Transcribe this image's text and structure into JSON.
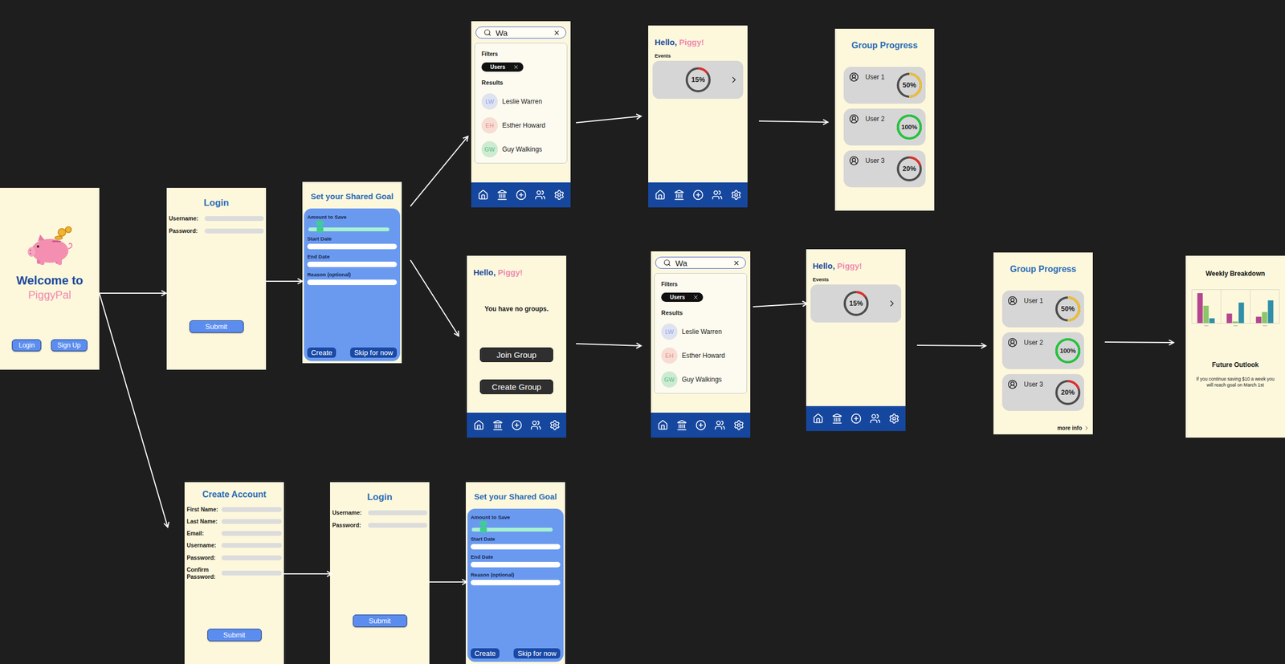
{
  "screens": [
    {
      "kind": "welcome",
      "title": "Welcome to",
      "brand": "PiggyPal",
      "buttons": [
        "Login",
        "Sign Up"
      ]
    },
    {
      "kind": "login",
      "title": "Login",
      "fields": [
        "Username:",
        "Password:"
      ],
      "submit": "Submit"
    },
    {
      "kind": "goal",
      "title": "Set your Shared Goal",
      "slider": {
        "label": "Amount to Save",
        "level": 0.14
      },
      "fields": [
        "Start Date",
        "End Date",
        "Reason (optional)"
      ],
      "buttons": [
        "Create",
        "Skip for now"
      ]
    },
    {
      "kind": "search",
      "query": "Wa",
      "filters_label": "Filters",
      "filters": [
        {
          "label": "Users",
          "selected": true
        }
      ],
      "results_label": "Results",
      "results": [
        {
          "initials": "LW",
          "name": "Leslie Warren",
          "color": "#8ea2f2"
        },
        {
          "initials": "EH",
          "name": "Esther Howard",
          "color": "#e98c8c"
        },
        {
          "initials": "GW",
          "name": "Guy Walkings",
          "color": "#4fbf85"
        }
      ]
    },
    {
      "kind": "events",
      "greeting": "Hello,",
      "name": "Piggy!",
      "section": "Events",
      "events": [
        {
          "level": 0.15,
          "reading": "15%",
          "color": "#e0302a"
        }
      ]
    },
    {
      "kind": "group",
      "title": "Group Progress",
      "members": [
        {
          "name": "User 1",
          "level": 0.5,
          "reading": "50%",
          "color": "#f2c230"
        },
        {
          "name": "User 2",
          "level": 1,
          "reading": "100%",
          "color": "#1fc93a"
        },
        {
          "name": "User 3",
          "level": 0.2,
          "reading": "20%",
          "color": "#e0302a"
        }
      ]
    },
    {
      "kind": "nogroups",
      "greeting": "Hello,",
      "name": "Piggy!",
      "message": "You have no groups.",
      "buttons": [
        "Join Group",
        "Create Group"
      ]
    },
    {
      "kind": "search",
      "query": "Wa",
      "filters_label": "Filters",
      "filters": [
        {
          "label": "Users",
          "selected": true
        }
      ],
      "results_label": "Results",
      "results": [
        {
          "initials": "LW",
          "name": "Leslie Warren",
          "color": "#8ea2f2"
        },
        {
          "initials": "EH",
          "name": "Esther Howard",
          "color": "#e98c8c"
        },
        {
          "initials": "GW",
          "name": "Guy Walkings",
          "color": "#4fbf85"
        }
      ]
    },
    {
      "kind": "events",
      "greeting": "Hello,",
      "name": "Piggy!",
      "section": "Events",
      "events": [
        {
          "level": 0.15,
          "reading": "15%",
          "color": "#e0302a"
        }
      ]
    },
    {
      "kind": "group",
      "title": "Group Progress",
      "members": [
        {
          "name": "User 1",
          "level": 0.5,
          "reading": "50%",
          "color": "#f2c230"
        },
        {
          "name": "User 2",
          "level": 1,
          "reading": "100%",
          "color": "#1fc93a"
        },
        {
          "name": "User 3",
          "level": 0.2,
          "reading": "20%",
          "color": "#e0302a"
        }
      ],
      "more": "more info"
    },
    {
      "kind": "weekly",
      "title": "Weekly Breakdown",
      "chart": {
        "series": [
          {
            "color": "#b5458f",
            "values": [
              95,
              30,
              20
            ]
          },
          {
            "color": "#8cc66b",
            "values": [
              55,
              5,
              35
            ]
          },
          {
            "color": "#2f8fa8",
            "values": [
              15,
              65,
              72
            ]
          }
        ]
      },
      "outlook_title": "Future Outlook",
      "outlook": "If you continue saving $10 a week you will reach goal on March 1st"
    },
    {
      "kind": "signup",
      "title": "Create Account",
      "fields": [
        "First Name:",
        "Last Name:",
        "Email:",
        "Username:",
        "Password:",
        "Confirm Password:"
      ],
      "submit": "Submit"
    },
    {
      "kind": "login",
      "title": "Login",
      "fields": [
        "Username:",
        "Password:"
      ],
      "submit": "Submit"
    },
    {
      "kind": "goal",
      "title": "Set your Shared Goal",
      "slider": {
        "label": "Amount to Save",
        "level": 0.14
      },
      "fields": [
        "Start Date",
        "End Date",
        "Reason (optional)"
      ],
      "buttons": [
        "Create",
        "Skip for now"
      ]
    }
  ]
}
